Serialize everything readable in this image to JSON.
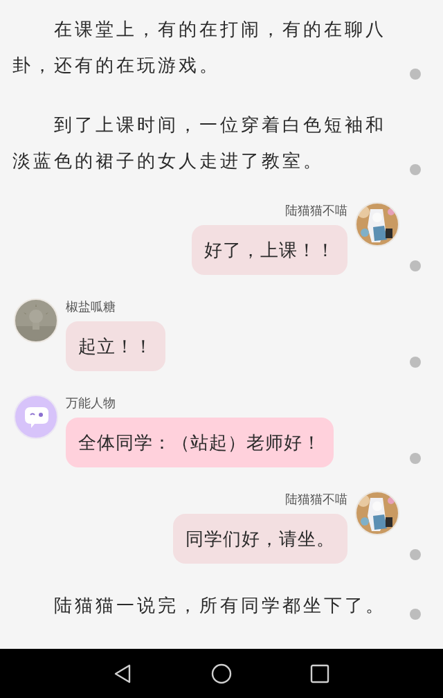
{
  "items": [
    {
      "kind": "narration",
      "text": "在课堂上，有的在打闹，有的在聊八卦，还有的在玩游戏。"
    },
    {
      "kind": "narration",
      "text": "到了上课时间，一位穿着白色短袖和淡蓝色的裙子的女人走进了教室。"
    },
    {
      "kind": "message",
      "outgoing": true,
      "name": "陆猫猫不喵",
      "text": "好了，上课！！",
      "color": "#f3dfe1"
    },
    {
      "kind": "message",
      "outgoing": false,
      "name": "椒盐呱糖",
      "text": "起立！！",
      "color": "#f3dfe1"
    },
    {
      "kind": "message",
      "outgoing": false,
      "name": "万能人物",
      "avatar": {
        "kind": "chat-icon"
      },
      "text": "全体同学：（站起）老师好！",
      "color": "#ffd1dc"
    },
    {
      "kind": "message",
      "outgoing": true,
      "name": "陆猫猫不喵",
      "text": "同学们好，请坐。",
      "color": "#f3dfe1"
    },
    {
      "kind": "narration",
      "text": "陆猫猫一说完，所有同学都坐下了。"
    }
  ]
}
